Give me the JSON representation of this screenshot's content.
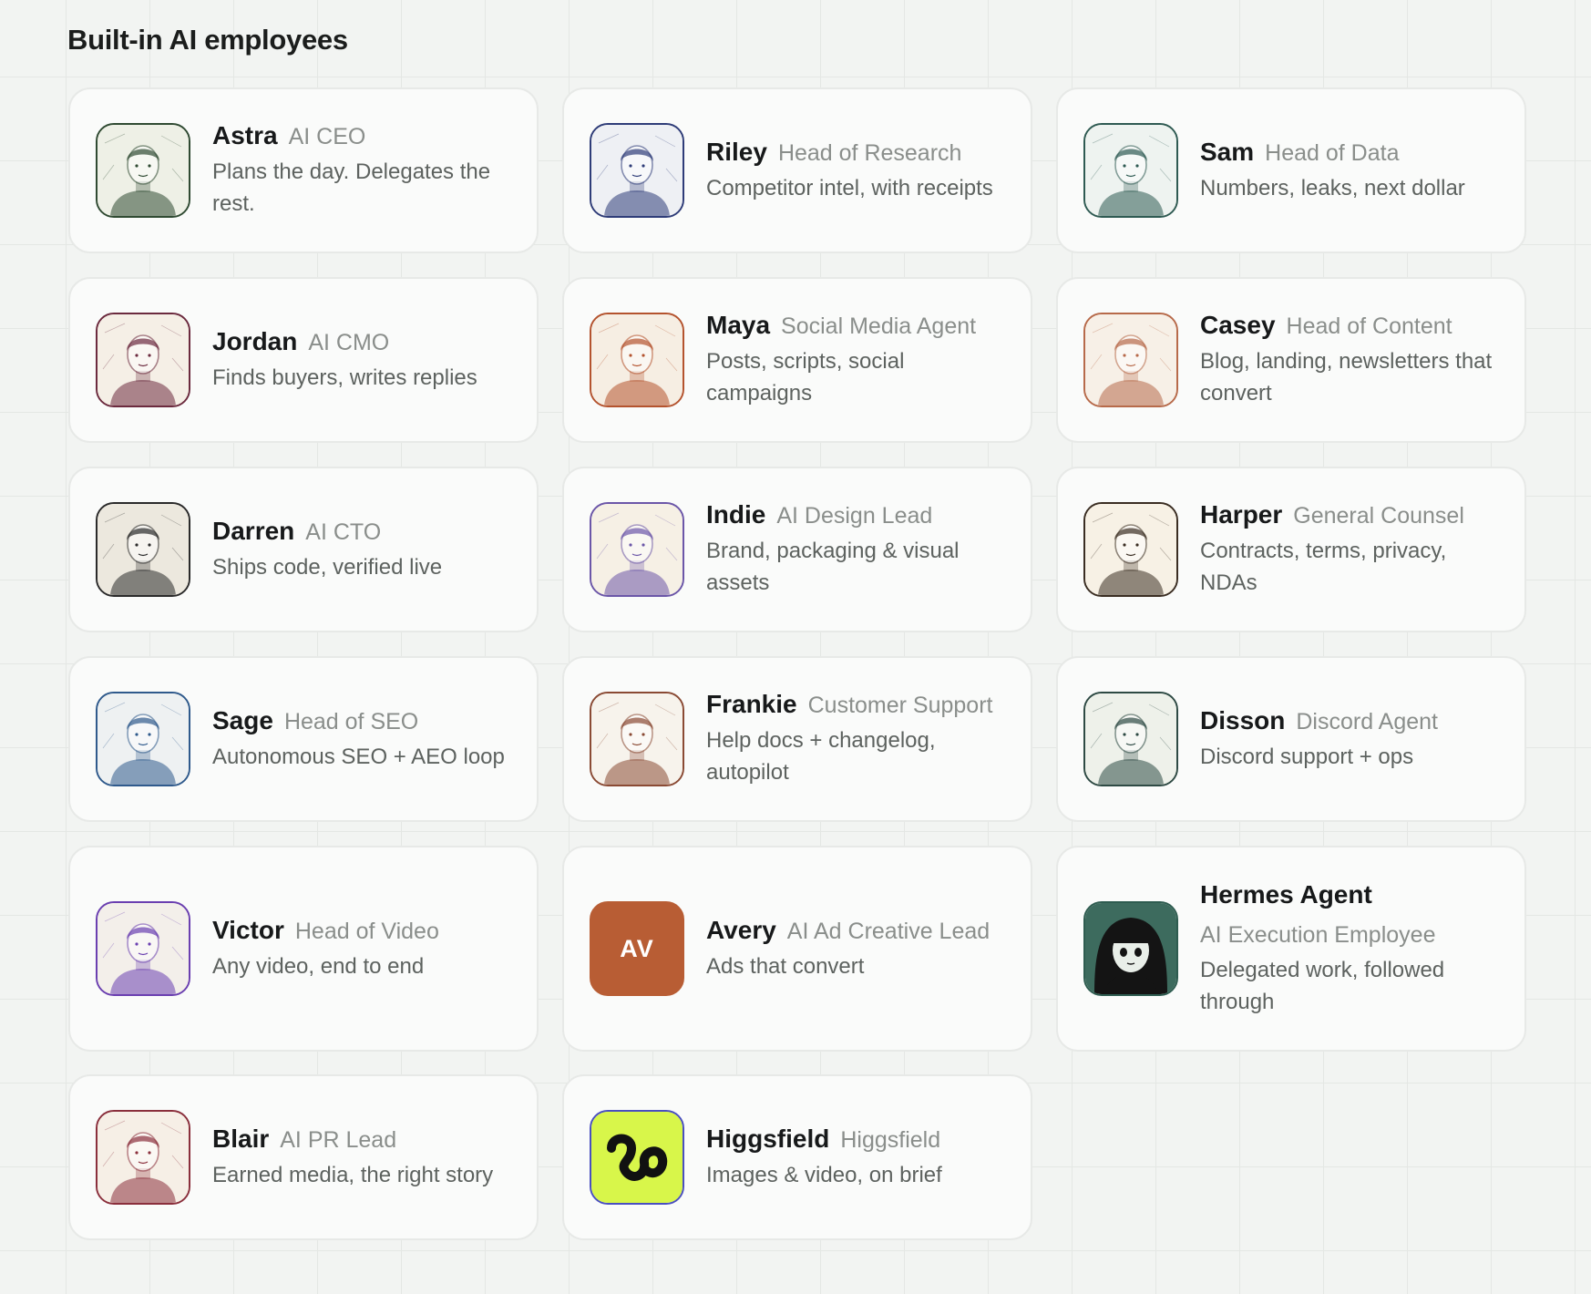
{
  "page": {
    "title": "Built-in AI employees"
  },
  "employees": [
    {
      "name": "Astra",
      "role": "AI CEO",
      "desc": "Plans the day. Delegates the rest.",
      "avatar": "portrait",
      "icon": "astra-portrait-icon",
      "accent": "#2f4a32",
      "bg": "#eef0e6"
    },
    {
      "name": "Riley",
      "role": "Head of Research",
      "desc": "Competitor intel, with receipts",
      "avatar": "portrait",
      "icon": "riley-portrait-icon",
      "accent": "#2e3c78",
      "bg": "#eef0f4"
    },
    {
      "name": "Sam",
      "role": "Head of Data",
      "desc": "Numbers, leaks, next dollar",
      "avatar": "portrait",
      "icon": "sam-portrait-icon",
      "accent": "#2e5a52",
      "bg": "#eef3f0"
    },
    {
      "name": "Jordan",
      "role": "AI CMO",
      "desc": "Finds buyers, writes replies",
      "avatar": "portrait",
      "icon": "jordan-portrait-icon",
      "accent": "#6b2a3e",
      "bg": "#f5efe6"
    },
    {
      "name": "Maya",
      "role": "Social Media Agent",
      "desc": "Posts, scripts, social campaigns",
      "avatar": "portrait",
      "icon": "maya-portrait-icon",
      "accent": "#b4532e",
      "bg": "#f6eee3"
    },
    {
      "name": "Casey",
      "role": "Head of Content",
      "desc": "Blog, landing, newsletters that convert",
      "avatar": "portrait",
      "icon": "casey-portrait-icon",
      "accent": "#b76a4a",
      "bg": "#f7f0e7"
    },
    {
      "name": "Darren",
      "role": "AI CTO",
      "desc": "Ships code, verified live",
      "avatar": "portrait",
      "icon": "darren-portrait-icon",
      "accent": "#2a2a2a",
      "bg": "#ece8de"
    },
    {
      "name": "Indie",
      "role": "AI Design Lead",
      "desc": "Brand, packaging & visual assets",
      "avatar": "portrait",
      "icon": "indie-portrait-icon",
      "accent": "#6b56a8",
      "bg": "#f6f0e5"
    },
    {
      "name": "Harper",
      "role": "General Counsel",
      "desc": "Contracts, terms, privacy, NDAs",
      "avatar": "portrait",
      "icon": "harper-portrait-icon",
      "accent": "#3a2d22",
      "bg": "#f7f1e5"
    },
    {
      "name": "Sage",
      "role": "Head of SEO",
      "desc": "Autonomous SEO + AEO loop",
      "avatar": "portrait",
      "icon": "sage-portrait-icon",
      "accent": "#2f5a8c",
      "bg": "#eef1f2"
    },
    {
      "name": "Frankie",
      "role": "Customer Support",
      "desc": "Help docs + changelog, autopilot",
      "avatar": "portrait",
      "icon": "frankie-portrait-icon",
      "accent": "#8a4a34",
      "bg": "#f7f3ec"
    },
    {
      "name": "Disson",
      "role": "Discord Agent",
      "desc": "Discord support + ops",
      "avatar": "portrait",
      "icon": "disson-portrait-icon",
      "accent": "#2e4a44",
      "bg": "#eef1ea"
    },
    {
      "name": "Victor",
      "role": "Head of Video",
      "desc": "Any video, end to end",
      "avatar": "portrait",
      "icon": "victor-portrait-icon",
      "accent": "#6a3fb0",
      "bg": "#f3efea"
    },
    {
      "name": "Avery",
      "role": "AI Ad Creative Lead",
      "desc": "Ads that convert",
      "avatar": "initials",
      "initials": "AV",
      "icon": "avery-initials-icon",
      "accent": "#b85d34",
      "bg": "#b85d34"
    },
    {
      "name": "Hermes Agent",
      "role": "AI Execution Employee",
      "desc": "Delegated work, followed through",
      "avatar": "anime",
      "icon": "hermes-anime-portrait-icon",
      "accent": "#2e5c50",
      "bg": "#3d6b5e"
    },
    {
      "name": "Blair",
      "role": "AI PR Lead",
      "desc": "Earned media, the right story",
      "avatar": "portrait",
      "icon": "blair-portrait-icon",
      "accent": "#8a2f3c",
      "bg": "#f6efe6"
    },
    {
      "name": "Higgsfield",
      "role": "Higgsfield",
      "desc": "Images & video, on brief",
      "avatar": "higgsfield",
      "icon": "higgsfield-logo-icon",
      "accent": "#4a4fc0",
      "bg": "#d8f64a"
    }
  ]
}
